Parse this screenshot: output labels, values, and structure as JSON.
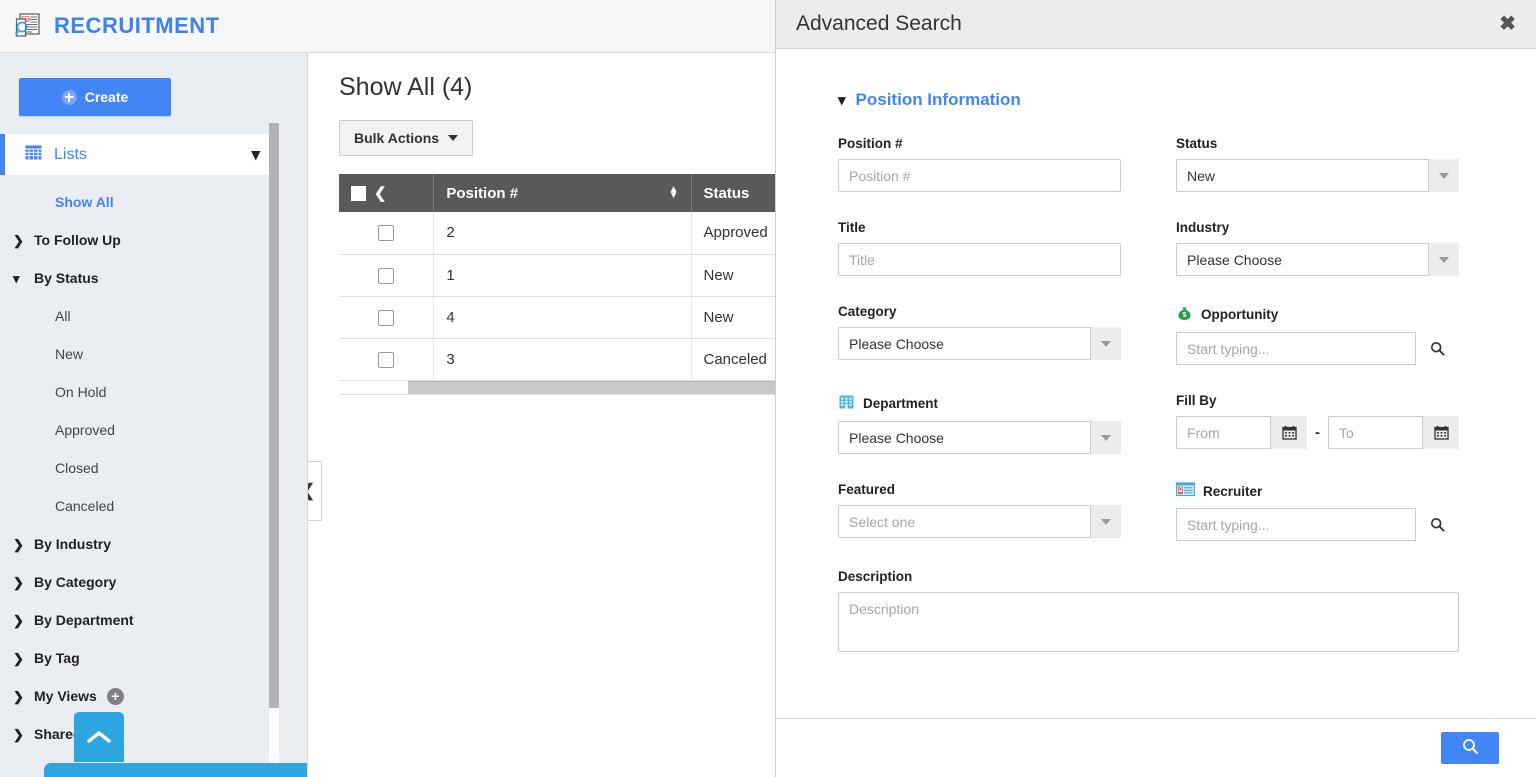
{
  "app": {
    "title": "RECRUITMENT",
    "logo_icon": "jobs-newspaper-search-icon",
    "accent_blue": "#4285f4",
    "accent_cyan": "#2ba6e0"
  },
  "sidebar": {
    "create_label": "Create",
    "create_icon": "plus-circle-icon",
    "lists_label": "Lists",
    "lists_icon": "grid-icon",
    "lists_chevron": "chevron-down-icon",
    "items": [
      {
        "label": "Show All",
        "type": "link",
        "icon": ""
      },
      {
        "label": "To Follow Up",
        "type": "group",
        "icon": "chevron-right-icon"
      },
      {
        "label": "By Status",
        "type": "group-open",
        "icon": "chevron-down-icon"
      },
      {
        "label": "All",
        "type": "child",
        "icon": ""
      },
      {
        "label": "New",
        "type": "child",
        "icon": ""
      },
      {
        "label": "On Hold",
        "type": "child",
        "icon": ""
      },
      {
        "label": "Approved",
        "type": "child",
        "icon": ""
      },
      {
        "label": "Closed",
        "type": "child",
        "icon": ""
      },
      {
        "label": "Canceled",
        "type": "child",
        "icon": ""
      },
      {
        "label": "By Industry",
        "type": "group",
        "icon": "chevron-right-icon"
      },
      {
        "label": "By Category",
        "type": "group",
        "icon": "chevron-right-icon"
      },
      {
        "label": "By Department",
        "type": "group",
        "icon": "chevron-right-icon"
      },
      {
        "label": "By Tag",
        "type": "group",
        "icon": "chevron-right-icon"
      },
      {
        "label": "My Views",
        "type": "group",
        "icon": "chevron-right-icon",
        "badge": "+"
      },
      {
        "label": "Shared Views",
        "type": "group",
        "icon": "chevron-right-icon"
      }
    ],
    "collapse_icon": "chevron-up-icon"
  },
  "main": {
    "page_title": "Show All (4)",
    "bulk_actions_label": "Bulk Actions",
    "bulk_actions_icon": "caret-down-icon",
    "collapse_handle_icon": "chevron-left-icon",
    "table": {
      "select_all_icon": "checkbox-icon",
      "columns_back_icon": "chevron-left-icon",
      "headers": [
        "Position #",
        "Status"
      ],
      "status_filter_icon": "filter-icon",
      "sort_icon": "sort-updown-icon",
      "rows": [
        {
          "checkbox": "",
          "position": "2",
          "status": "Approved"
        },
        {
          "checkbox": "",
          "position": "1",
          "status": "New"
        },
        {
          "checkbox": "",
          "position": "4",
          "status": "New"
        },
        {
          "checkbox": "",
          "position": "3",
          "status": "Canceled"
        }
      ]
    }
  },
  "panel": {
    "title": "Advanced Search",
    "close_icon": "close-icon",
    "section": {
      "label": "Position Information",
      "chevron": "chevron-down-icon"
    },
    "fields": {
      "position_number": {
        "label": "Position #",
        "placeholder": "Position #",
        "value": ""
      },
      "status": {
        "label": "Status",
        "value": "New",
        "arrow_icon": "caret-down-icon"
      },
      "title": {
        "label": "Title",
        "placeholder": "Title",
        "value": ""
      },
      "industry": {
        "label": "Industry",
        "value": "Please Choose",
        "arrow_icon": "caret-down-icon"
      },
      "category": {
        "label": "Category",
        "value": "Please Choose",
        "arrow_icon": "caret-down-icon"
      },
      "opportunity": {
        "label": "Opportunity",
        "icon": "money-bag-icon",
        "placeholder": "Start typing...",
        "value": "",
        "search_icon": "search-icon"
      },
      "department": {
        "label": "Department",
        "icon": "building-icon",
        "value": "Please Choose",
        "arrow_icon": "caret-down-icon"
      },
      "fill_by": {
        "label": "Fill By",
        "from_placeholder": "From",
        "to_placeholder": "To",
        "from_value": "",
        "to_value": "",
        "separator": "-",
        "calendar_icon": "calendar-icon"
      },
      "featured": {
        "label": "Featured",
        "value": "Select one",
        "arrow_icon": "caret-down-icon"
      },
      "recruiter": {
        "label": "Recruiter",
        "icon": "contact-card-icon",
        "placeholder": "Start typing...",
        "value": "",
        "search_icon": "search-icon"
      },
      "description": {
        "label": "Description",
        "placeholder": "Description",
        "value": ""
      }
    },
    "footer": {
      "search_button_icon": "search-icon"
    }
  }
}
